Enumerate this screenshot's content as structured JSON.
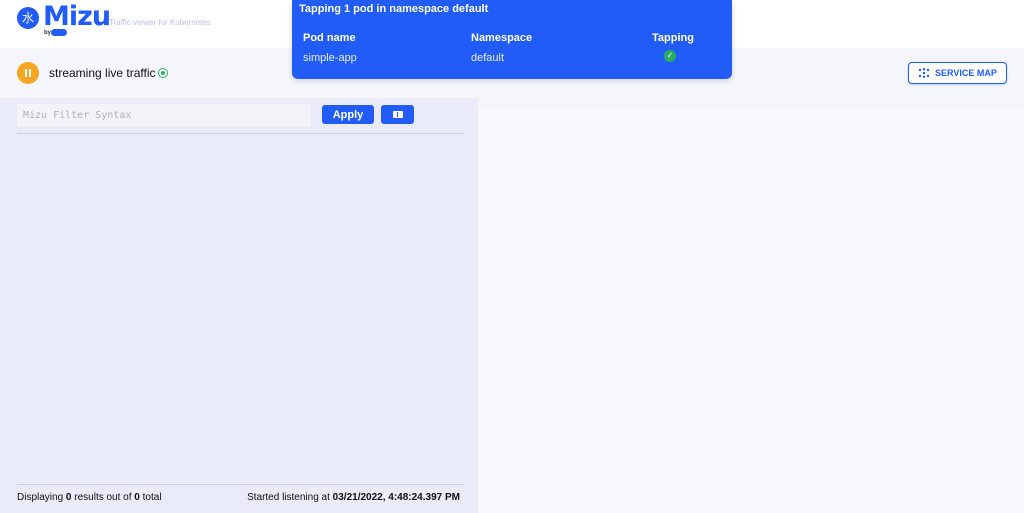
{
  "header": {
    "logo_glyph": "水",
    "brand": "Mizu",
    "by": "by",
    "tagline": "Traffic viewer for Kubernetes"
  },
  "tapping_popup": {
    "title": "Tapping 1 pod in namespace default",
    "columns": [
      "Pod name",
      "Namespace",
      "Tapping"
    ],
    "rows": [
      {
        "pod_name": "simple-app",
        "namespace": "default",
        "tapping_icon": "check-icon"
      }
    ]
  },
  "status": {
    "pause_icon": "pause-icon",
    "streaming_label": "streaming live traffic",
    "live_indicator": "live-dot-icon",
    "service_map_label": "SERVICE MAP"
  },
  "filter": {
    "placeholder": "Mizu Filter Syntax",
    "value": "",
    "apply_label": "Apply",
    "docs_icon": "book-icon"
  },
  "footer": {
    "displaying_prefix": "Displaying ",
    "results_count": "0",
    "results_middle": " results out of ",
    "total_count": "0",
    "total_suffix": " total",
    "started_prefix": "Started listening at ",
    "started_at": "03/21/2022, 4:48:24.397 PM"
  },
  "colors": {
    "primary": "#205cf5",
    "pause": "#f5a623",
    "live": "#27ae60",
    "panel_left": "#e9ebf8",
    "panel_right": "#f8f9fc"
  }
}
